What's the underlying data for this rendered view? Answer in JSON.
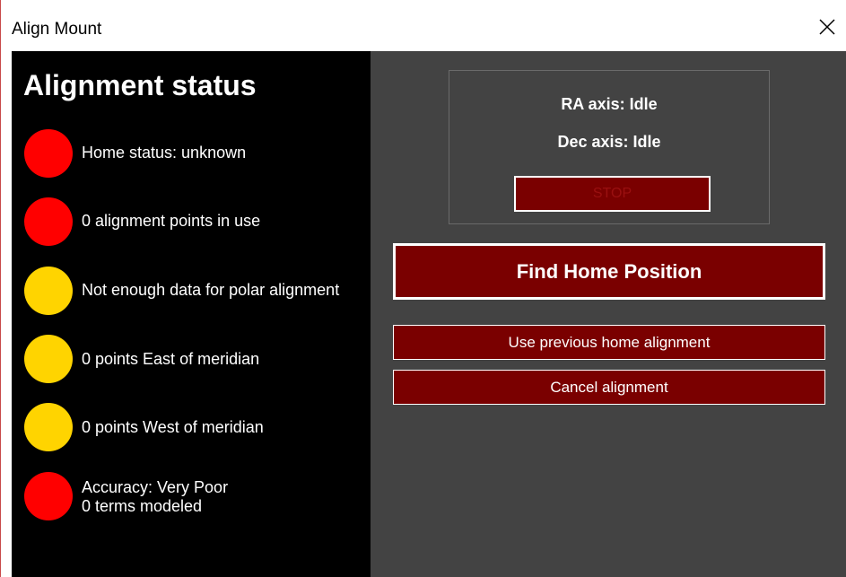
{
  "window": {
    "title": "Align Mount",
    "close_icon": "close-icon"
  },
  "left": {
    "heading": "Alignment status",
    "items": [
      {
        "status": "red",
        "line1": "Home status: unknown"
      },
      {
        "status": "red",
        "line1": "0 alignment points in use"
      },
      {
        "status": "yellow",
        "line1": "Not enough data for polar alignment"
      },
      {
        "status": "yellow",
        "line1": "0 points East of meridian"
      },
      {
        "status": "yellow",
        "line1": "0 points West of meridian"
      },
      {
        "status": "red",
        "line1": "Accuracy: Very Poor",
        "line2": "0 terms modeled"
      }
    ]
  },
  "right": {
    "ra_axis": "RA axis:  Idle",
    "dec_axis": "Dec axis:  Idle",
    "stop_label": "STOP",
    "find_home_label": "Find Home Position",
    "use_previous_label": "Use previous home alignment",
    "cancel_label": "Cancel alignment"
  },
  "colors": {
    "red": "#ff0000",
    "yellow": "#ffd400",
    "button_bg": "#7a0000",
    "panel_dark": "#434343",
    "panel_black": "#000000"
  }
}
